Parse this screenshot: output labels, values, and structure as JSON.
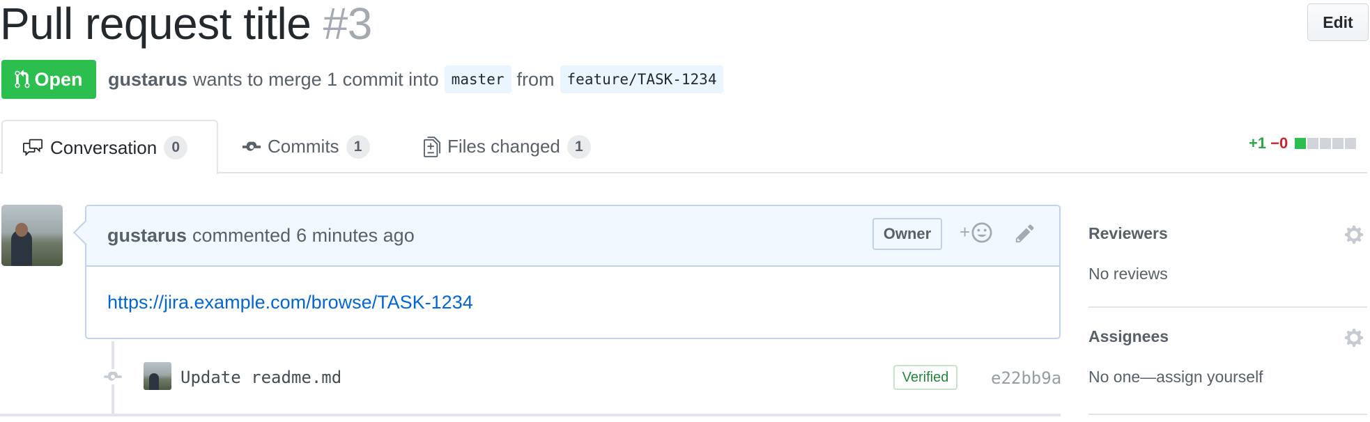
{
  "header": {
    "title": "Pull request title",
    "number": "#3",
    "edit_label": "Edit"
  },
  "state": {
    "label": "Open",
    "icon": "git-pull-request-icon",
    "color": "#2cbe4e"
  },
  "meta": {
    "author": "gustarus",
    "text1": "wants to merge 1 commit into",
    "base_branch": "master",
    "text2": "from",
    "head_branch": "feature/TASK-1234"
  },
  "tabs": [
    {
      "label": "Conversation",
      "count": "0",
      "icon": "comment-discussion-icon",
      "selected": true
    },
    {
      "label": "Commits",
      "count": "1",
      "icon": "git-commit-icon"
    },
    {
      "label": "Files changed",
      "count": "1",
      "icon": "file-diff-icon"
    }
  ],
  "diffstat": {
    "additions": "+1",
    "deletions": "−0",
    "blocks": [
      "added",
      "neutral",
      "neutral",
      "neutral",
      "neutral"
    ]
  },
  "comment": {
    "author": "gustarus",
    "action": "commented",
    "time": "6 minutes ago",
    "badge": "Owner",
    "reaction_icon": "smiley-icon",
    "edit_icon": "pencil-icon",
    "body_link": "https://jira.example.com/browse/TASK-1234"
  },
  "commit": {
    "message": "Update readme.md",
    "verified": "Verified",
    "sha": "e22bb9a"
  },
  "sidebar": {
    "reviewers": {
      "heading": "Reviewers",
      "value": "No reviews"
    },
    "assignees": {
      "heading": "Assignees",
      "value": "No one—assign yourself"
    }
  },
  "colors": {
    "link": "#0366d6",
    "additions": "#28a745",
    "deletions": "#cb2431",
    "comment_header_bg": "#f1f8ff"
  }
}
